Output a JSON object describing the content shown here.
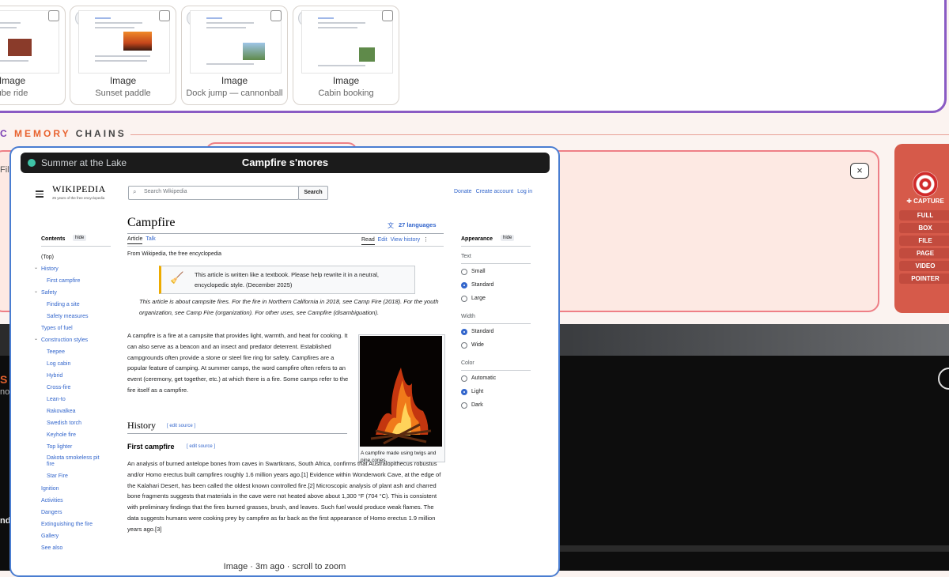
{
  "memory_cards": [
    {
      "kind": "Image",
      "title": "ube ride"
    },
    {
      "kind": "Image",
      "title": "Sunset paddle"
    },
    {
      "kind": "Image",
      "title": "Dock jump — cannonball"
    },
    {
      "kind": "Image",
      "title": "Cabin booking"
    }
  ],
  "chains_header": {
    "part1": "C",
    "part2": "MEMORY",
    "part3": "CHAINS"
  },
  "capture": {
    "title": "✚ CAPTURE",
    "options": [
      "FULL",
      "BOX",
      "FILE",
      "PAGE",
      "VIDEO",
      "POINTER"
    ]
  },
  "edge_texts": {
    "filt": "Filt",
    "s": "S",
    "no": "no",
    "nd": "nd"
  },
  "popup": {
    "chain_name": "Summer at the Lake",
    "memory_name": "Campfire s'mores",
    "footer": "Image · 3m ago   ·   scroll to zoom",
    "close_icon": "×"
  },
  "wiki": {
    "logo": "WIKIPEDIA",
    "logo_sub": "25 years of the free encyclopedia",
    "search_placeholder": "Search Wikipedia",
    "search_button": "Search",
    "top_links": [
      "Donate",
      "Create account",
      "Log in"
    ],
    "page_title": "Campfire",
    "languages": "27 languages",
    "tabs_left": [
      "Article",
      "Talk"
    ],
    "tabs_right": [
      "Read",
      "Edit",
      "View history"
    ],
    "from": "From Wikipedia, the free encyclopedia",
    "notice_text": "This article is written like a textbook. Please help rewrite it in a neutral, encyclopedic style. (December 2025)",
    "hatnote": "This article is about campsite fires. For the fire in Northern California in 2018, see Camp Fire (2018). For the youth organization, see Camp Fire (organization). For other uses, see Campfire (disambiguation).",
    "intro": "A campfire is a fire at a campsite that provides light, warmth, and heat for cooking. It can also serve as a beacon and an insect and predator deterrent. Established campgrounds often provide a stone or steel fire ring for safety. Campfires are a popular feature of camping. At summer camps, the word campfire often refers to an event (ceremony, get together, etc.) at which there is a fire. Some camps refer to the fire itself as a campfire.",
    "figure_caption": "A campfire made using twigs and pine cones.",
    "history_heading": "History",
    "edit_source": "[ edit source ]",
    "first_heading": "First campfire",
    "first_para": "An analysis of burned antelope bones from caves in Swartkrans, South Africa, confirms that Australopithecus robustus and/or Homo erectus built campfires roughly 1.6 million years ago.[1] Evidence within Wonderwork Cave, at the edge of the Kalahari Desert, has been called the oldest known controlled fire.[2] Microscopic analysis of plant ash and charred bone fragments suggests that materials in the cave were not heated above about 1,300 °F (704 °C). This is consistent with preliminary findings that the fires burned grasses, brush, and leaves. Such fuel would produce weak flames. The data suggests humans were cooking prey by campfire as far back as the first appearance of Homo erectus 1.9 million years ago.[3]",
    "contents": {
      "heading": "Contents",
      "hide": "hide",
      "items": [
        "(Top)",
        "History",
        "First campfire",
        "Safety",
        "Finding a site",
        "Safety measures",
        "Types of fuel",
        "Construction styles",
        "Teepee",
        "Log cabin",
        "Hybrid",
        "Cross-fire",
        "Lean-to",
        "Rakovalkea",
        "Swedish torch",
        "Keyhole fire",
        "Top lighter",
        "Dakota smokeless pit fire",
        "Star Fire",
        "Ignition",
        "Activities",
        "Dangers",
        "Extinguishing the fire",
        "Gallery",
        "See also"
      ]
    },
    "appearance": {
      "heading": "Appearance",
      "hide": "hide",
      "text_label": "Text",
      "text_options": [
        "Small",
        "Standard",
        "Large"
      ],
      "width_label": "Width",
      "width_options": [
        "Standard",
        "Wide"
      ],
      "color_label": "Color",
      "color_options": [
        "Automatic",
        "Light",
        "Dark"
      ]
    }
  },
  "colors": {
    "accent": "#8a5bc4",
    "chain_border": "#ee7f86",
    "capture": "#d65a4a",
    "popup_border": "#4a7dd1",
    "link": "#3366cc"
  }
}
